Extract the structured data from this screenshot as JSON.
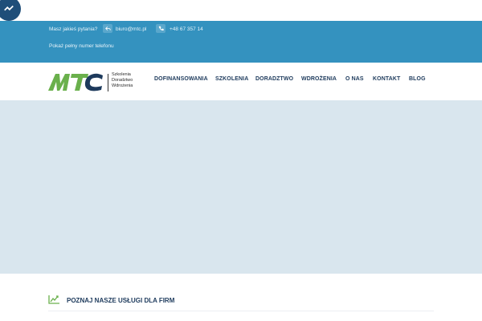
{
  "topbar": {
    "question": "Masz jakieś pytania?",
    "email": "biuro@mtc.pl",
    "phone": "+48 67 357 14",
    "show_phone": "Pokaż pełny numer telefonu"
  },
  "logo": {
    "mark": "MTC",
    "line1": "Szkolenia",
    "line2": "Doradztwo",
    "line3": "Wdrożenia"
  },
  "nav": {
    "items": [
      "DOFINANSOWANIA",
      "SZKOLENIA",
      "DORADZTWO",
      "WDROŻENIA",
      "O NAS",
      "KONTAKT",
      "BLOG"
    ]
  },
  "section": {
    "title": "POZNAJ NASZE USŁUGI DLA FIRM"
  },
  "colors": {
    "topbar": "#3492bf",
    "navy": "#1d3a5c",
    "green": "#6ab04c",
    "banner": "#d9e6ee"
  },
  "icons": {
    "chat": "messenger-icon",
    "email": "reply-arrow-icon",
    "phone": "phone-icon",
    "section": "chart-trend-icon"
  }
}
